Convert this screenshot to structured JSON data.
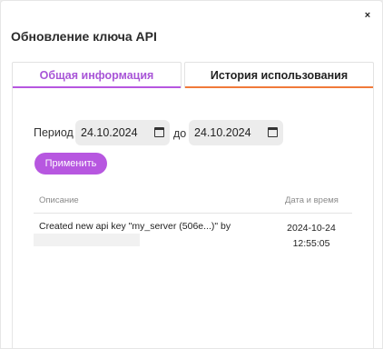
{
  "dialog": {
    "title": "Обновление ключа API",
    "close_glyph": "×"
  },
  "tabs": [
    {
      "label": "Общая информация",
      "color": "#b657e0"
    },
    {
      "label": "История использования",
      "color": "#f07a3a"
    }
  ],
  "filter": {
    "period_label": "Период",
    "from_value": "24.10.2024",
    "to_label": "до",
    "to_value": "24.10.2024",
    "apply_label": "Применить"
  },
  "table": {
    "columns": [
      "Описание",
      "Дата и время"
    ],
    "rows": [
      {
        "description": "Created new api key \"my_server (506e...)\" by",
        "date": "2024-10-24",
        "time": "12:55:05"
      }
    ]
  },
  "accent_color": "#b757e0"
}
